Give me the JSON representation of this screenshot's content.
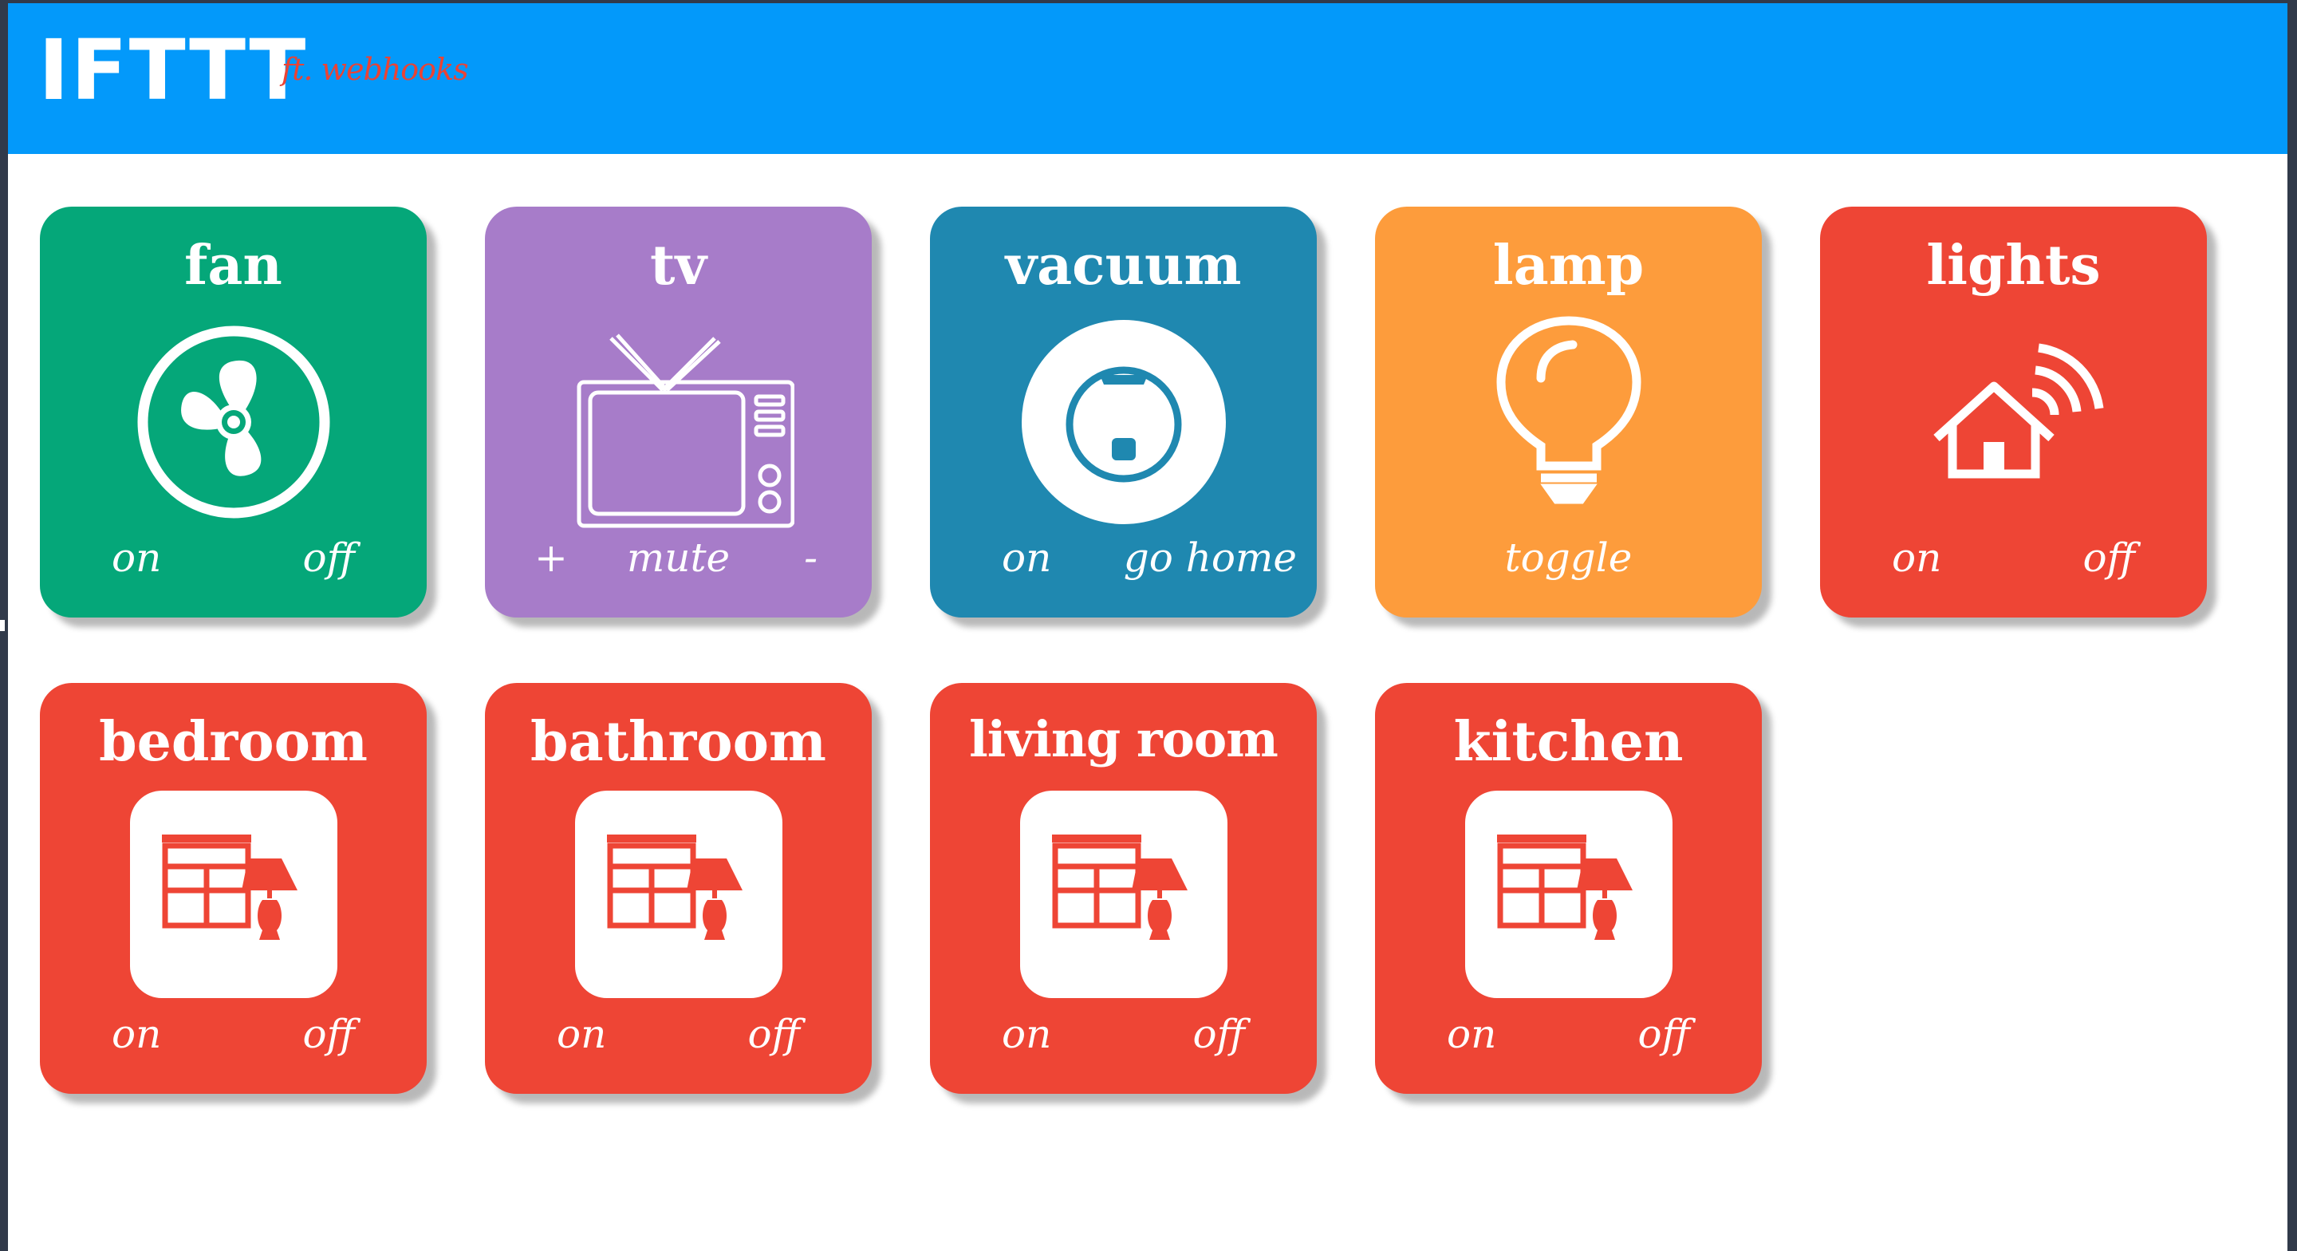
{
  "header": {
    "logo": "IFTTT",
    "subtitle": "ft. webhooks",
    "bg_color": "#0399fa"
  },
  "colors": {
    "green": "#05a779",
    "purple": "#a77cc9",
    "teal": "#1f88b0",
    "orange": "#fd9c3c",
    "red": "#ee4535"
  },
  "tiles": {
    "fan": {
      "title": "fan",
      "icon": "fan-icon",
      "actions": [
        "on",
        "off"
      ]
    },
    "tv": {
      "title": "tv",
      "icon": "tv-icon",
      "actions": [
        "+",
        "mute",
        "-"
      ]
    },
    "vacuum": {
      "title": "vacuum",
      "icon": "robot-vacuum-icon",
      "actions": [
        "on",
        "go home"
      ]
    },
    "lamp": {
      "title": "lamp",
      "icon": "lightbulb-icon",
      "actions": [
        "toggle"
      ]
    },
    "lights": {
      "title": "lights",
      "icon": "smart-home-icon",
      "actions": [
        "on",
        "off"
      ]
    },
    "bedroom": {
      "title": "bedroom",
      "icon": "room-lamp-icon",
      "actions": [
        "on",
        "off"
      ]
    },
    "bathroom": {
      "title": "bathroom",
      "icon": "room-lamp-icon",
      "actions": [
        "on",
        "off"
      ]
    },
    "living_room": {
      "title": "living room",
      "icon": "room-lamp-icon",
      "actions": [
        "on",
        "off"
      ]
    },
    "kitchen": {
      "title": "kitchen",
      "icon": "room-lamp-icon",
      "actions": [
        "on",
        "off"
      ]
    }
  }
}
